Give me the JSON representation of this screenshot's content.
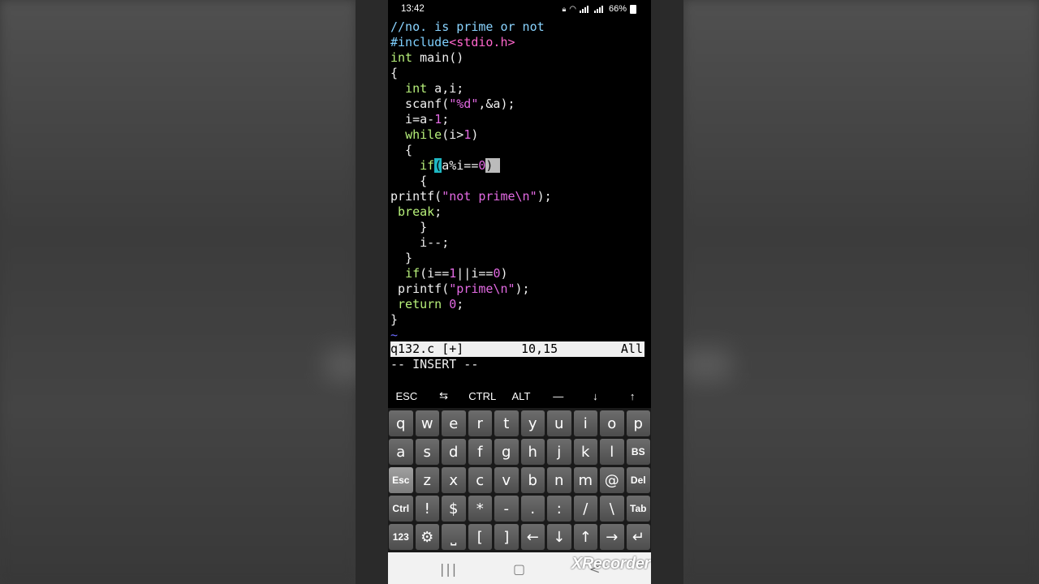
{
  "status_bar": {
    "time": "13:42",
    "network1": "VoLTE LTE1",
    "network2": "VoLTE LTE2",
    "battery": "66%"
  },
  "editor": {
    "lines": [
      {
        "segs": [
          {
            "t": "//no. is prime or not",
            "c": "cm"
          }
        ]
      },
      {
        "segs": [
          {
            "t": "#include",
            "c": "pp"
          },
          {
            "t": "<stdio.h>",
            "c": "ppinc"
          }
        ]
      },
      {
        "segs": [
          {
            "t": "int",
            "c": "ty"
          },
          {
            "t": " main()",
            "c": ""
          }
        ]
      },
      {
        "segs": [
          {
            "t": "{",
            "c": ""
          }
        ]
      },
      {
        "segs": [
          {
            "t": "  ",
            "c": ""
          },
          {
            "t": "int",
            "c": "ty"
          },
          {
            "t": " a,i;",
            "c": ""
          }
        ]
      },
      {
        "segs": [
          {
            "t": "  scanf(",
            "c": ""
          },
          {
            "t": "\"%d\"",
            "c": "st"
          },
          {
            "t": ",&a);",
            "c": ""
          }
        ]
      },
      {
        "segs": [
          {
            "t": "  i=a-",
            "c": ""
          },
          {
            "t": "1",
            "c": "nm"
          },
          {
            "t": ";",
            "c": ""
          }
        ]
      },
      {
        "segs": [
          {
            "t": "  ",
            "c": ""
          },
          {
            "t": "while",
            "c": "kw"
          },
          {
            "t": "(i>",
            "c": ""
          },
          {
            "t": "1",
            "c": "nm"
          },
          {
            "t": ")",
            "c": ""
          }
        ]
      },
      {
        "segs": [
          {
            "t": "  {",
            "c": ""
          }
        ]
      },
      {
        "segs": [
          {
            "t": "    ",
            "c": ""
          },
          {
            "t": "if",
            "c": "kw"
          },
          {
            "t": "(",
            "c": "cur-hl"
          },
          {
            "t": "a%i==",
            "c": ""
          },
          {
            "t": "0",
            "c": "nm"
          },
          {
            "t": ")",
            "c": "cur-hl2"
          },
          {
            "t": " ",
            "c": "cur-hl2"
          }
        ]
      },
      {
        "segs": [
          {
            "t": "    {",
            "c": ""
          }
        ]
      },
      {
        "segs": [
          {
            "t": "printf(",
            "c": ""
          },
          {
            "t": "\"not prime\\n\"",
            "c": "st"
          },
          {
            "t": ");",
            "c": ""
          }
        ]
      },
      {
        "segs": [
          {
            "t": " ",
            "c": ""
          },
          {
            "t": "break",
            "c": "kw"
          },
          {
            "t": ";",
            "c": ""
          }
        ]
      },
      {
        "segs": [
          {
            "t": "    }",
            "c": ""
          }
        ]
      },
      {
        "segs": [
          {
            "t": "    i--;",
            "c": ""
          }
        ]
      },
      {
        "segs": [
          {
            "t": "  }",
            "c": ""
          }
        ]
      },
      {
        "segs": [
          {
            "t": "  ",
            "c": ""
          },
          {
            "t": "if",
            "c": "kw"
          },
          {
            "t": "(i==",
            "c": ""
          },
          {
            "t": "1",
            "c": "nm"
          },
          {
            "t": "||i==",
            "c": ""
          },
          {
            "t": "0",
            "c": "nm"
          },
          {
            "t": ")",
            "c": ""
          }
        ]
      },
      {
        "segs": [
          {
            "t": " printf(",
            "c": ""
          },
          {
            "t": "\"prime\\n\"",
            "c": "st"
          },
          {
            "t": ");",
            "c": ""
          }
        ]
      },
      {
        "segs": [
          {
            "t": " ",
            "c": ""
          },
          {
            "t": "return",
            "c": "kw"
          },
          {
            "t": " ",
            "c": ""
          },
          {
            "t": "0",
            "c": "nm"
          },
          {
            "t": ";",
            "c": ""
          }
        ]
      },
      {
        "segs": [
          {
            "t": "}",
            "c": ""
          }
        ]
      },
      {
        "segs": [
          {
            "t": "~",
            "c": "tilde"
          }
        ]
      }
    ],
    "statusline": {
      "file": "q132.c [+]",
      "pos": "10,15",
      "scroll": "All"
    },
    "mode": "-- INSERT --"
  },
  "extra_keys": [
    "ESC",
    "⇆",
    "CTRL",
    "ALT",
    "—",
    "↓",
    "↑"
  ],
  "keyboard": {
    "rows": [
      [
        "q",
        "w",
        "e",
        "r",
        "t",
        "y",
        "u",
        "i",
        "o",
        "p"
      ],
      [
        "a",
        "s",
        "d",
        "f",
        "g",
        "h",
        "j",
        "k",
        "l",
        "BS"
      ],
      [
        "Esc",
        "z",
        "x",
        "c",
        "v",
        "b",
        "n",
        "m",
        "@",
        "Del"
      ],
      [
        "Ctrl",
        "!",
        "$",
        "*",
        "-",
        ".",
        ":",
        "/",
        "\\",
        "Tab"
      ],
      [
        "123",
        "⚙",
        "⎵",
        "[",
        "]",
        "←",
        "↓",
        "↑",
        "→",
        "↵"
      ]
    ]
  },
  "nav": {
    "recents": "|||",
    "home": "▢",
    "back": "<"
  },
  "watermark": "XRecorder",
  "colors": {
    "code_bg": "#000000",
    "keyword": "#b7f07a",
    "string": "#e36ae3",
    "comment": "#8ad4ff",
    "cursor": "#1fb8c3"
  }
}
